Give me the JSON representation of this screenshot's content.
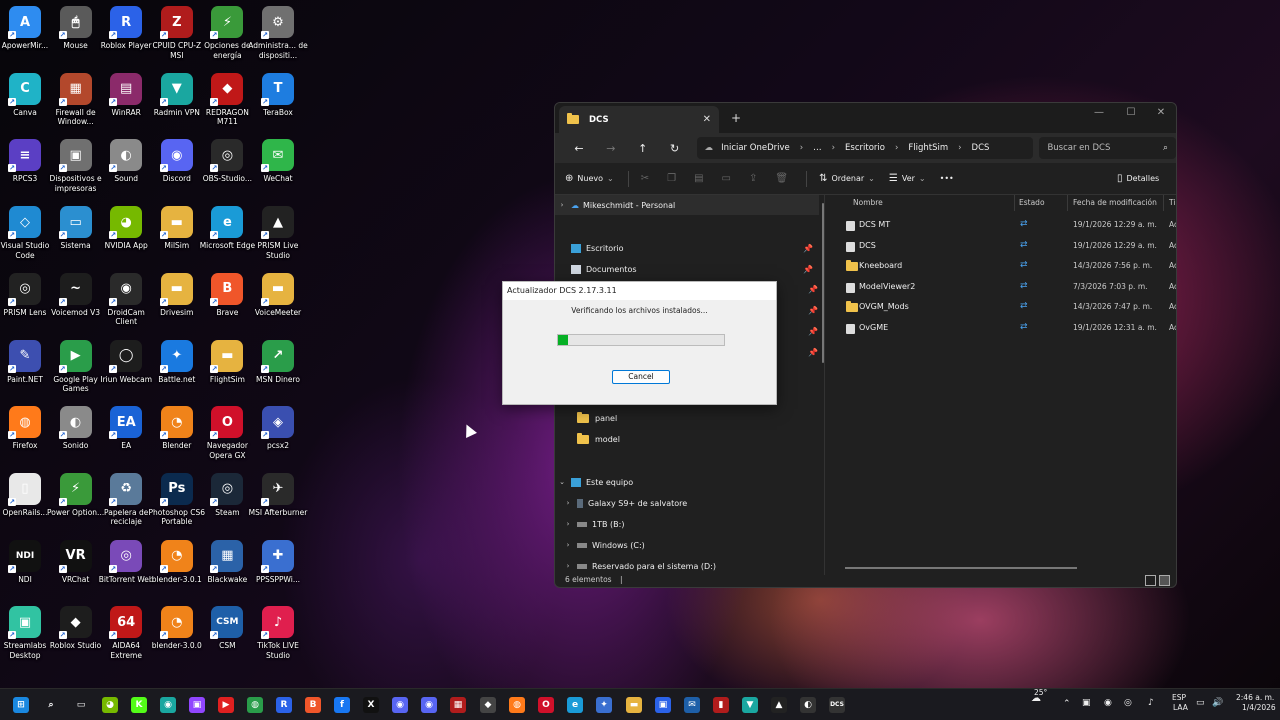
{
  "desktop_icons": [
    {
      "label": "ApowerMir...",
      "glyph": "A",
      "color": "#2e8cf0",
      "col": 0,
      "row": 0
    },
    {
      "label": "Mouse",
      "glyph": "🖱",
      "color": "#5a5a5a",
      "col": 1,
      "row": 0
    },
    {
      "label": "Roblox Player",
      "glyph": "R",
      "color": "#2b62e8",
      "col": 2,
      "row": 0
    },
    {
      "label": "CPUID CPU-Z MSI",
      "glyph": "Z",
      "color": "#b01c1c",
      "col": 3,
      "row": 0
    },
    {
      "label": "Opciones de energía",
      "glyph": "⚡",
      "color": "#3a9a3a",
      "col": 4,
      "row": 0
    },
    {
      "label": "Administra... de dispositi...",
      "glyph": "⚙",
      "color": "#707070",
      "col": 5,
      "row": 0
    },
    {
      "label": "Canva",
      "glyph": "C",
      "color": "#1fb3c7",
      "col": 0,
      "row": 1
    },
    {
      "label": "Firewall de Window...",
      "glyph": "▦",
      "color": "#b3482c",
      "col": 1,
      "row": 1
    },
    {
      "label": "WinRAR",
      "glyph": "▤",
      "color": "#8b2a6a",
      "col": 2,
      "row": 1
    },
    {
      "label": "Radmin VPN",
      "glyph": "▼",
      "color": "#1aa7a0",
      "col": 3,
      "row": 1
    },
    {
      "label": "REDRAGON M711",
      "glyph": "◆",
      "color": "#c01818",
      "col": 4,
      "row": 1
    },
    {
      "label": "TeraBox",
      "glyph": "T",
      "color": "#1e7de0",
      "col": 5,
      "row": 1
    },
    {
      "label": "RPCS3",
      "glyph": "≡",
      "color": "#5b3fc4",
      "col": 0,
      "row": 2
    },
    {
      "label": "Dispositivos e impresoras",
      "glyph": "▣",
      "color": "#707070",
      "col": 1,
      "row": 2
    },
    {
      "label": "Sound",
      "glyph": "◐",
      "color": "#8a8a8a",
      "col": 2,
      "row": 2
    },
    {
      "label": "Discord",
      "glyph": "◉",
      "color": "#5865f2",
      "col": 3,
      "row": 2
    },
    {
      "label": "OBS-Studio...",
      "glyph": "◎",
      "color": "#2a2a2a",
      "col": 4,
      "row": 2
    },
    {
      "label": "WeChat",
      "glyph": "✉",
      "color": "#2fb64a",
      "col": 5,
      "row": 2
    },
    {
      "label": "Visual Studio Code",
      "glyph": "◇",
      "color": "#1f8ad2",
      "col": 0,
      "row": 3
    },
    {
      "label": "Sistema",
      "glyph": "▭",
      "color": "#2b8fd0",
      "col": 1,
      "row": 3
    },
    {
      "label": "NVIDIA App",
      "glyph": "◕",
      "color": "#76b900",
      "col": 2,
      "row": 3
    },
    {
      "label": "MilSim",
      "glyph": "▬",
      "color": "#e6b340",
      "col": 3,
      "row": 3
    },
    {
      "label": "Microsoft Edge",
      "glyph": "e",
      "color": "#1a9bd7",
      "col": 4,
      "row": 3
    },
    {
      "label": "PRISM Live Studio",
      "glyph": "▲",
      "color": "#222222",
      "col": 5,
      "row": 3
    },
    {
      "label": "PRISM Lens",
      "glyph": "◎",
      "color": "#222222",
      "col": 0,
      "row": 4
    },
    {
      "label": "Voicemod V3",
      "glyph": "~",
      "color": "#1d1d1d",
      "col": 1,
      "row": 4
    },
    {
      "label": "DroidCam Client",
      "glyph": "◉",
      "color": "#2a2a2a",
      "col": 2,
      "row": 4
    },
    {
      "label": "Drivesim",
      "glyph": "▬",
      "color": "#e6b340",
      "col": 3,
      "row": 4
    },
    {
      "label": "Brave",
      "glyph": "B",
      "color": "#f0562a",
      "col": 4,
      "row": 4
    },
    {
      "label": "VoiceMeeter",
      "glyph": "▬",
      "color": "#e6b340",
      "col": 5,
      "row": 4
    },
    {
      "label": "Paint.NET",
      "glyph": "✎",
      "color": "#3d4fb0",
      "col": 0,
      "row": 5
    },
    {
      "label": "Google Play Games",
      "glyph": "▶",
      "color": "#2a9d4a",
      "col": 1,
      "row": 5
    },
    {
      "label": "Iriun Webcam",
      "glyph": "◯",
      "color": "#1d1d1d",
      "col": 2,
      "row": 5
    },
    {
      "label": "Battle.net",
      "glyph": "✦",
      "color": "#1a7ae0",
      "col": 3,
      "row": 5
    },
    {
      "label": "FlightSim",
      "glyph": "▬",
      "color": "#e6b340",
      "col": 4,
      "row": 5
    },
    {
      "label": "MSN Dinero",
      "glyph": "↗",
      "color": "#2a9d4a",
      "col": 5,
      "row": 5
    },
    {
      "label": "Firefox",
      "glyph": "◍",
      "color": "#ff7a1a",
      "col": 0,
      "row": 6
    },
    {
      "label": "Sonido",
      "glyph": "◐",
      "color": "#8a8a8a",
      "col": 1,
      "row": 6
    },
    {
      "label": "EA",
      "glyph": "EA",
      "color": "#1a63d6",
      "col": 2,
      "row": 6
    },
    {
      "label": "Blender",
      "glyph": "◔",
      "color": "#f0831a",
      "col": 3,
      "row": 6
    },
    {
      "label": "Navegador Opera GX",
      "glyph": "O",
      "color": "#d0102a",
      "col": 4,
      "row": 6
    },
    {
      "label": "pcsx2",
      "glyph": "◈",
      "color": "#3a4fb0",
      "col": 5,
      "row": 6
    },
    {
      "label": "OpenRails...",
      "glyph": "▯",
      "color": "#e8e8e8",
      "col": 0,
      "row": 7
    },
    {
      "label": "Power Option...",
      "glyph": "⚡",
      "color": "#3a9a3a",
      "col": 1,
      "row": 7
    },
    {
      "label": "Papelera de reciclaje",
      "glyph": "♻",
      "color": "#5a7a9a",
      "col": 2,
      "row": 7
    },
    {
      "label": "Photoshop CS6 Portable",
      "glyph": "Ps",
      "color": "#0b2a4e",
      "col": 3,
      "row": 7
    },
    {
      "label": "Steam",
      "glyph": "◎",
      "color": "#1b2838",
      "col": 4,
      "row": 7
    },
    {
      "label": "MSI Afterburner",
      "glyph": "✈",
      "color": "#2a2a2a",
      "col": 5,
      "row": 7
    },
    {
      "label": "NDI",
      "glyph": "NDI",
      "color": "#111111",
      "col": 0,
      "row": 8
    },
    {
      "label": "VRChat",
      "glyph": "VR",
      "color": "#111111",
      "col": 1,
      "row": 8
    },
    {
      "label": "BitTorrent Web",
      "glyph": "◎",
      "color": "#7a4ab8",
      "col": 2,
      "row": 8
    },
    {
      "label": "blender-3.0.1",
      "glyph": "◔",
      "color": "#f0831a",
      "col": 3,
      "row": 8
    },
    {
      "label": "Blackwake",
      "glyph": "▦",
      "color": "#2b62a8",
      "col": 4,
      "row": 8
    },
    {
      "label": "PPSSPPWi...",
      "glyph": "✚",
      "color": "#3a6fd0",
      "col": 5,
      "row": 8
    },
    {
      "label": "Streamlabs Desktop",
      "glyph": "▣",
      "color": "#31c3a2",
      "col": 0,
      "row": 9
    },
    {
      "label": "Roblox Studio",
      "glyph": "◆",
      "color": "#1d1d1d",
      "col": 1,
      "row": 9
    },
    {
      "label": "AIDA64 Extreme",
      "glyph": "64",
      "color": "#c01818",
      "col": 2,
      "row": 9
    },
    {
      "label": "blender-3.0.0",
      "glyph": "◔",
      "color": "#f0831a",
      "col": 3,
      "row": 9
    },
    {
      "label": "CSM",
      "glyph": "CSM",
      "color": "#1e5fa8",
      "col": 4,
      "row": 9
    },
    {
      "label": "TikTok LIVE Studio",
      "glyph": "♪",
      "color": "#e01f4e",
      "col": 5,
      "row": 9
    }
  ],
  "explorer": {
    "tab_title": "DCS",
    "tab_close": "✕",
    "new_tab": "+",
    "minimize": "—",
    "maximize": "☐",
    "close": "✕",
    "back": "←",
    "forward": "→",
    "up": "↑",
    "refresh": "↻",
    "breadcrumb": [
      "Iniciar OneDrive",
      "…",
      "Escritorio",
      "FlightSim",
      "DCS"
    ],
    "search_placeholder": "Buscar en DCS",
    "toolbar": {
      "new_label": "Nuevo",
      "sort_label": "Ordenar",
      "view_label": "Ver",
      "more_label": "•••",
      "details_label": "Detalles"
    },
    "nav": {
      "onedrive_label": "Mikeschmidt - Personal",
      "escritorio_label": "Escritorio",
      "documentos_label": "Documentos",
      "panel_label": "panel",
      "model_label": "model",
      "este_equipo_label": "Este equipo",
      "galaxy_label": "Galaxy S9+ de salvatore",
      "drive_b_label": "1TB (B:)",
      "drive_c_label": "Windows (C:)",
      "drive_d_label": "Reservado para el sistema (D:)"
    },
    "columns": {
      "name": "Nombre",
      "status": "Estado",
      "date": "Fecha de modificación",
      "type": "Tip"
    },
    "files": [
      {
        "name": "DCS MT",
        "date": "19/1/2026 12:29 a. m.",
        "type": "Ac",
        "kind": "doc"
      },
      {
        "name": "DCS",
        "date": "19/1/2026 12:29 a. m.",
        "type": "Ac",
        "kind": "doc"
      },
      {
        "name": "Kneeboard",
        "date": "14/3/2026 7:56 p. m.",
        "type": "Ac",
        "kind": "folder"
      },
      {
        "name": "ModelViewer2",
        "date": "7/3/2026 7:03 p. m.",
        "type": "Ac",
        "kind": "doc"
      },
      {
        "name": "OVGM_Mods",
        "date": "14/3/2026 7:47 p. m.",
        "type": "Ac",
        "kind": "folder"
      },
      {
        "name": "OvGME",
        "date": "19/1/2026 12:31 a. m.",
        "type": "Ac",
        "kind": "doc"
      }
    ],
    "status_text": "6 elementos",
    "status_sep": "|"
  },
  "dialog": {
    "title": "Actualizador DCS 2.17.3.11",
    "message": "Verificando los archivos instalados...",
    "progress": 0.06,
    "cancel_label": "Cancel"
  },
  "taskbar": {
    "temperature": "25°",
    "language": "ESP",
    "layout": "LAA",
    "time": "2:46 a. m.",
    "date": "1/4/2026"
  },
  "colors": {
    "accent": "#0078d7",
    "progress": "#06b025",
    "sync": "#4aa3f0"
  }
}
